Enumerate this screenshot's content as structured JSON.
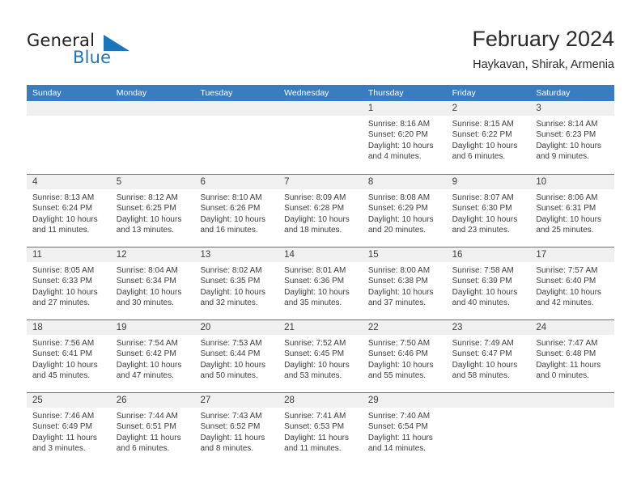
{
  "brand": {
    "name_part1": "General",
    "name_part2": "Blue",
    "logo_icon": "triangle-logo-icon"
  },
  "header": {
    "title": "February 2024",
    "location": "Haykavan, Shirak, Armenia"
  },
  "colors": {
    "header_blue": "#3a7cc0",
    "brand_blue": "#1b75bb",
    "day_band_gray": "#f0f0f0",
    "text": "#3d3d3d"
  },
  "weekdays": [
    "Sunday",
    "Monday",
    "Tuesday",
    "Wednesday",
    "Thursday",
    "Friday",
    "Saturday"
  ],
  "weeks": [
    [
      {
        "day": "",
        "empty": true
      },
      {
        "day": "",
        "empty": true
      },
      {
        "day": "",
        "empty": true
      },
      {
        "day": "",
        "empty": true
      },
      {
        "day": "1",
        "sunrise": "Sunrise: 8:16 AM",
        "sunset": "Sunset: 6:20 PM",
        "daylight": "Daylight: 10 hours and 4 minutes."
      },
      {
        "day": "2",
        "sunrise": "Sunrise: 8:15 AM",
        "sunset": "Sunset: 6:22 PM",
        "daylight": "Daylight: 10 hours and 6 minutes."
      },
      {
        "day": "3",
        "sunrise": "Sunrise: 8:14 AM",
        "sunset": "Sunset: 6:23 PM",
        "daylight": "Daylight: 10 hours and 9 minutes."
      }
    ],
    [
      {
        "day": "4",
        "sunrise": "Sunrise: 8:13 AM",
        "sunset": "Sunset: 6:24 PM",
        "daylight": "Daylight: 10 hours and 11 minutes."
      },
      {
        "day": "5",
        "sunrise": "Sunrise: 8:12 AM",
        "sunset": "Sunset: 6:25 PM",
        "daylight": "Daylight: 10 hours and 13 minutes."
      },
      {
        "day": "6",
        "sunrise": "Sunrise: 8:10 AM",
        "sunset": "Sunset: 6:26 PM",
        "daylight": "Daylight: 10 hours and 16 minutes."
      },
      {
        "day": "7",
        "sunrise": "Sunrise: 8:09 AM",
        "sunset": "Sunset: 6:28 PM",
        "daylight": "Daylight: 10 hours and 18 minutes."
      },
      {
        "day": "8",
        "sunrise": "Sunrise: 8:08 AM",
        "sunset": "Sunset: 6:29 PM",
        "daylight": "Daylight: 10 hours and 20 minutes."
      },
      {
        "day": "9",
        "sunrise": "Sunrise: 8:07 AM",
        "sunset": "Sunset: 6:30 PM",
        "daylight": "Daylight: 10 hours and 23 minutes."
      },
      {
        "day": "10",
        "sunrise": "Sunrise: 8:06 AM",
        "sunset": "Sunset: 6:31 PM",
        "daylight": "Daylight: 10 hours and 25 minutes."
      }
    ],
    [
      {
        "day": "11",
        "sunrise": "Sunrise: 8:05 AM",
        "sunset": "Sunset: 6:33 PM",
        "daylight": "Daylight: 10 hours and 27 minutes."
      },
      {
        "day": "12",
        "sunrise": "Sunrise: 8:04 AM",
        "sunset": "Sunset: 6:34 PM",
        "daylight": "Daylight: 10 hours and 30 minutes."
      },
      {
        "day": "13",
        "sunrise": "Sunrise: 8:02 AM",
        "sunset": "Sunset: 6:35 PM",
        "daylight": "Daylight: 10 hours and 32 minutes."
      },
      {
        "day": "14",
        "sunrise": "Sunrise: 8:01 AM",
        "sunset": "Sunset: 6:36 PM",
        "daylight": "Daylight: 10 hours and 35 minutes."
      },
      {
        "day": "15",
        "sunrise": "Sunrise: 8:00 AM",
        "sunset": "Sunset: 6:38 PM",
        "daylight": "Daylight: 10 hours and 37 minutes."
      },
      {
        "day": "16",
        "sunrise": "Sunrise: 7:58 AM",
        "sunset": "Sunset: 6:39 PM",
        "daylight": "Daylight: 10 hours and 40 minutes."
      },
      {
        "day": "17",
        "sunrise": "Sunrise: 7:57 AM",
        "sunset": "Sunset: 6:40 PM",
        "daylight": "Daylight: 10 hours and 42 minutes."
      }
    ],
    [
      {
        "day": "18",
        "sunrise": "Sunrise: 7:56 AM",
        "sunset": "Sunset: 6:41 PM",
        "daylight": "Daylight: 10 hours and 45 minutes."
      },
      {
        "day": "19",
        "sunrise": "Sunrise: 7:54 AM",
        "sunset": "Sunset: 6:42 PM",
        "daylight": "Daylight: 10 hours and 47 minutes."
      },
      {
        "day": "20",
        "sunrise": "Sunrise: 7:53 AM",
        "sunset": "Sunset: 6:44 PM",
        "daylight": "Daylight: 10 hours and 50 minutes."
      },
      {
        "day": "21",
        "sunrise": "Sunrise: 7:52 AM",
        "sunset": "Sunset: 6:45 PM",
        "daylight": "Daylight: 10 hours and 53 minutes."
      },
      {
        "day": "22",
        "sunrise": "Sunrise: 7:50 AM",
        "sunset": "Sunset: 6:46 PM",
        "daylight": "Daylight: 10 hours and 55 minutes."
      },
      {
        "day": "23",
        "sunrise": "Sunrise: 7:49 AM",
        "sunset": "Sunset: 6:47 PM",
        "daylight": "Daylight: 10 hours and 58 minutes."
      },
      {
        "day": "24",
        "sunrise": "Sunrise: 7:47 AM",
        "sunset": "Sunset: 6:48 PM",
        "daylight": "Daylight: 11 hours and 0 minutes."
      }
    ],
    [
      {
        "day": "25",
        "sunrise": "Sunrise: 7:46 AM",
        "sunset": "Sunset: 6:49 PM",
        "daylight": "Daylight: 11 hours and 3 minutes."
      },
      {
        "day": "26",
        "sunrise": "Sunrise: 7:44 AM",
        "sunset": "Sunset: 6:51 PM",
        "daylight": "Daylight: 11 hours and 6 minutes."
      },
      {
        "day": "27",
        "sunrise": "Sunrise: 7:43 AM",
        "sunset": "Sunset: 6:52 PM",
        "daylight": "Daylight: 11 hours and 8 minutes."
      },
      {
        "day": "28",
        "sunrise": "Sunrise: 7:41 AM",
        "sunset": "Sunset: 6:53 PM",
        "daylight": "Daylight: 11 hours and 11 minutes."
      },
      {
        "day": "29",
        "sunrise": "Sunrise: 7:40 AM",
        "sunset": "Sunset: 6:54 PM",
        "daylight": "Daylight: 11 hours and 14 minutes."
      },
      {
        "day": "",
        "empty": true
      },
      {
        "day": "",
        "empty": true
      }
    ]
  ]
}
